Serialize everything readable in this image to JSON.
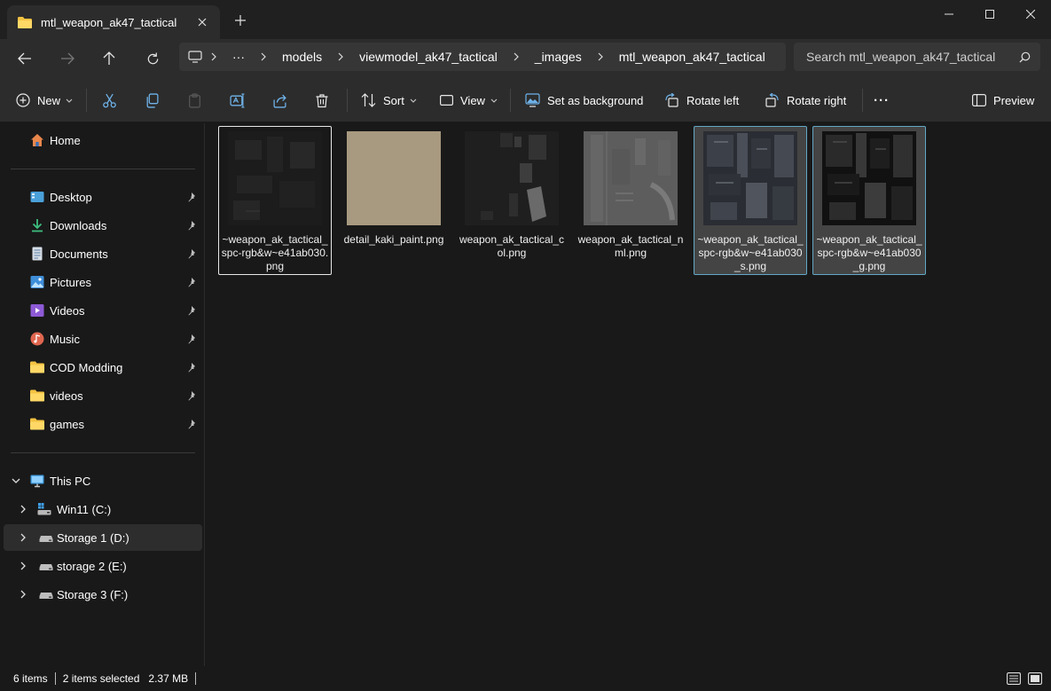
{
  "window": {
    "tab_title": "mtl_weapon_ak47_tactical",
    "new_tab": "+",
    "controls": [
      "minimize",
      "maximize",
      "close"
    ]
  },
  "address": {
    "more": "···",
    "crumbs": [
      "models",
      "viewmodel_ak47_tactical",
      "_images",
      "mtl_weapon_ak47_tactical"
    ],
    "search_placeholder": "Search mtl_weapon_ak47_tactical"
  },
  "toolbar": {
    "new_label": "New",
    "sort_label": "Sort",
    "view_label": "View",
    "set_bg_label": "Set as background",
    "rotate_left_label": "Rotate left",
    "rotate_right_label": "Rotate right",
    "more_label": "···",
    "preview_label": "Preview"
  },
  "sidebar": {
    "home": "Home",
    "quick_access": [
      {
        "label": "Desktop",
        "icon": "desktop-icon"
      },
      {
        "label": "Downloads",
        "icon": "downloads-icon"
      },
      {
        "label": "Documents",
        "icon": "documents-icon"
      },
      {
        "label": "Pictures",
        "icon": "pictures-icon"
      },
      {
        "label": "Videos",
        "icon": "videos-icon"
      },
      {
        "label": "Music",
        "icon": "music-icon"
      },
      {
        "label": "COD Modding",
        "icon": "folder-icon"
      },
      {
        "label": "videos",
        "icon": "folder-icon"
      },
      {
        "label": "games",
        "icon": "folder-icon"
      }
    ],
    "this_pc": "This PC",
    "drives": [
      {
        "label": "Win11 (C:)",
        "icon": "windows-drive-icon"
      },
      {
        "label": "Storage 1 (D:)",
        "icon": "drive-icon",
        "selected": true
      },
      {
        "label": "storage 2 (E:)",
        "icon": "drive-icon"
      },
      {
        "label": "Storage 3 (F:)",
        "icon": "drive-icon"
      }
    ]
  },
  "files": [
    {
      "name": "~weapon_ak_tactical_spc-rgb&w~e41ab030.png",
      "state": "focus",
      "thumb": "dark-texture"
    },
    {
      "name": "detail_kaki_paint.png",
      "state": "normal",
      "thumb": "khaki-solid"
    },
    {
      "name": "weapon_ak_tactical_col.png",
      "state": "normal",
      "thumb": "color-map"
    },
    {
      "name": "weapon_ak_tactical_nml.png",
      "state": "normal",
      "thumb": "normal-map"
    },
    {
      "name": "~weapon_ak_tactical_spc-rgb&w~e41ab030_s.png",
      "state": "selected",
      "thumb": "specular-map"
    },
    {
      "name": "~weapon_ak_tactical_spc-rgb&w~e41ab030_g.png",
      "state": "selected",
      "thumb": "gloss-map"
    }
  ],
  "status": {
    "item_count": "6 items",
    "selection": "2 items selected",
    "size": "2.37 MB"
  },
  "colors": {
    "accent": "#63a7c6",
    "folder": "#f5c342",
    "background": "#191919",
    "chrome": "#2c2c2c"
  }
}
